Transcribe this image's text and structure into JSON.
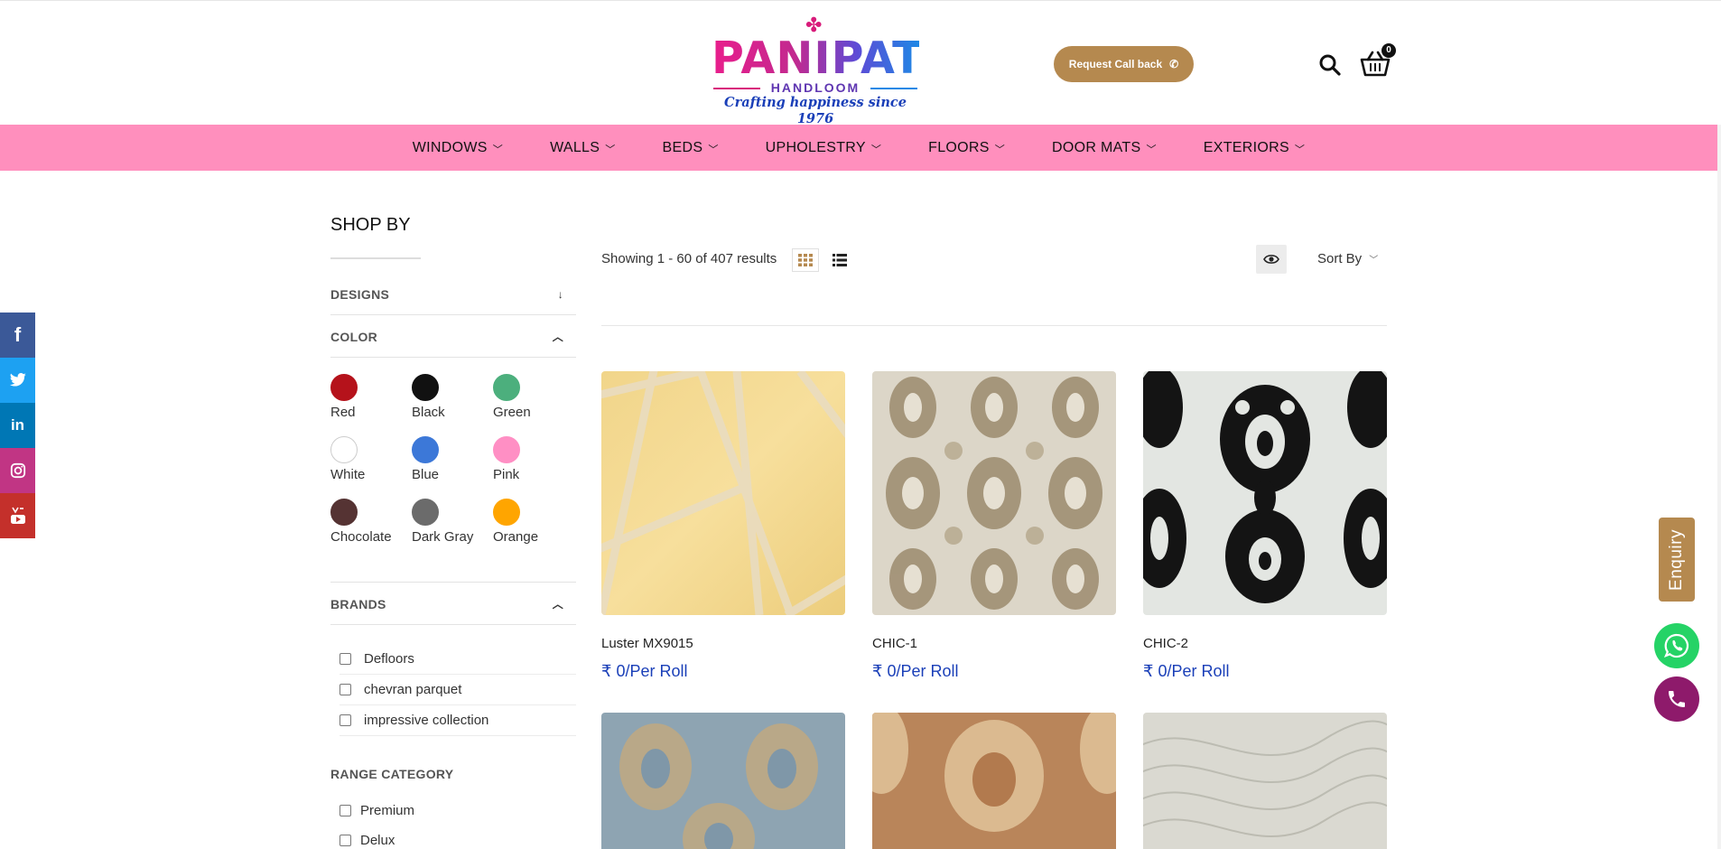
{
  "brand": {
    "logo_word": "PANIPAT",
    "logo_sub": "HANDLOOM",
    "tagline": "Crafting happiness since 1976"
  },
  "header": {
    "callback_label": "Request Call back",
    "cart_count": "0"
  },
  "nav": {
    "items": [
      "WINDOWS",
      "WALLS",
      "BEDS",
      "UPHOLESTRY",
      "FLOORS",
      "DOOR MATS",
      "EXTERIORS"
    ]
  },
  "sidebar": {
    "title": "SHOP BY",
    "designs_label": "DESIGNS",
    "color_label": "COLOR",
    "colors": [
      {
        "name": "Red",
        "hex": "#b5121b"
      },
      {
        "name": "Black",
        "hex": "#111111"
      },
      {
        "name": "Green",
        "hex": "#4caf7d"
      },
      {
        "name": "White",
        "hex": "#ffffff"
      },
      {
        "name": "Blue",
        "hex": "#3c78d8"
      },
      {
        "name": "Pink",
        "hex": "#ff8fc4"
      },
      {
        "name": "Chocolate",
        "hex": "#553333"
      },
      {
        "name": "Dark Gray",
        "hex": "#6b6b6b"
      },
      {
        "name": "Orange",
        "hex": "#ffa500"
      }
    ],
    "brands_label": "BRANDS",
    "brands": [
      "Defloors",
      "chevran parquet",
      "impressive collection"
    ],
    "range_label": "RANGE CATEGORY",
    "ranges": [
      "Premium",
      "Delux"
    ]
  },
  "toolbar": {
    "results_text": "Showing 1 - 60 of 407 results",
    "sort_label": "Sort By"
  },
  "products": [
    {
      "name": "Luster MX9015",
      "price": "₹ 0/Per Roll",
      "pattern": "geometric-yellow"
    },
    {
      "name": "CHIC-1",
      "price": "₹ 0/Per Roll",
      "pattern": "damask-beige"
    },
    {
      "name": "CHIC-2",
      "price": "₹ 0/Per Roll",
      "pattern": "damask-black"
    },
    {
      "name": "",
      "price": "",
      "pattern": "damask-blue"
    },
    {
      "name": "",
      "price": "",
      "pattern": "damask-brown"
    },
    {
      "name": "",
      "price": "",
      "pattern": "swirl-gray"
    }
  ],
  "floating": {
    "enquiry_label": "Enquiry"
  },
  "social": [
    "facebook-icon",
    "twitter-icon",
    "linkedin-icon",
    "instagram-icon",
    "youtube-icon"
  ]
}
